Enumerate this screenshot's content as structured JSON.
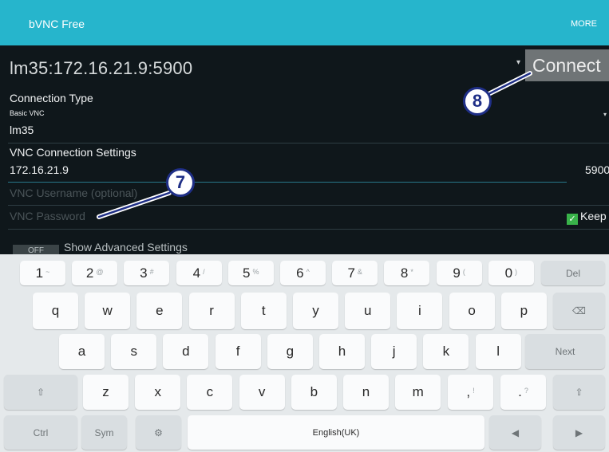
{
  "app": {
    "title": "bVNC Free",
    "more_label": "MORE"
  },
  "connection": {
    "selected": "lm35:172.16.21.9:5900",
    "connect_label": "Connect"
  },
  "connection_type": {
    "label": "Connection Type",
    "sub": "Basic VNC",
    "value": "lm35"
  },
  "vnc_settings": {
    "label": "VNC Connection Settings",
    "host": "172.16.21.9",
    "port": "5900",
    "username_placeholder": "VNC Username (optional)",
    "password_placeholder": "VNC Password",
    "keep_label": "Keep"
  },
  "advanced": {
    "toggle_label": "OFF",
    "label": "Show Advanced Settings"
  },
  "annotations": [
    "7",
    "8"
  ],
  "keyboard": {
    "row1": [
      {
        "k": "1",
        "a": "~"
      },
      {
        "k": "2",
        "a": "@"
      },
      {
        "k": "3",
        "a": "#"
      },
      {
        "k": "4",
        "a": "/"
      },
      {
        "k": "5",
        "a": "%"
      },
      {
        "k": "6",
        "a": "^"
      },
      {
        "k": "7",
        "a": "&"
      },
      {
        "k": "8",
        "a": "*"
      },
      {
        "k": "9",
        "a": "("
      },
      {
        "k": "0",
        "a": ")"
      }
    ],
    "del_label": "Del",
    "row2": [
      "q",
      "w",
      "e",
      "r",
      "t",
      "y",
      "u",
      "i",
      "o",
      "p"
    ],
    "row3": [
      "a",
      "s",
      "d",
      "f",
      "g",
      "h",
      "j",
      "k",
      "l"
    ],
    "next_label": "Next",
    "row4": [
      "z",
      "x",
      "c",
      "v",
      "b",
      "n",
      "m"
    ],
    "comma": {
      "k": ",",
      "a": "!"
    },
    "period": {
      "k": ".",
      "a": "?"
    },
    "ctrl_label": "Ctrl",
    "sym_label": "Sym",
    "space_label": "English(UK)"
  }
}
